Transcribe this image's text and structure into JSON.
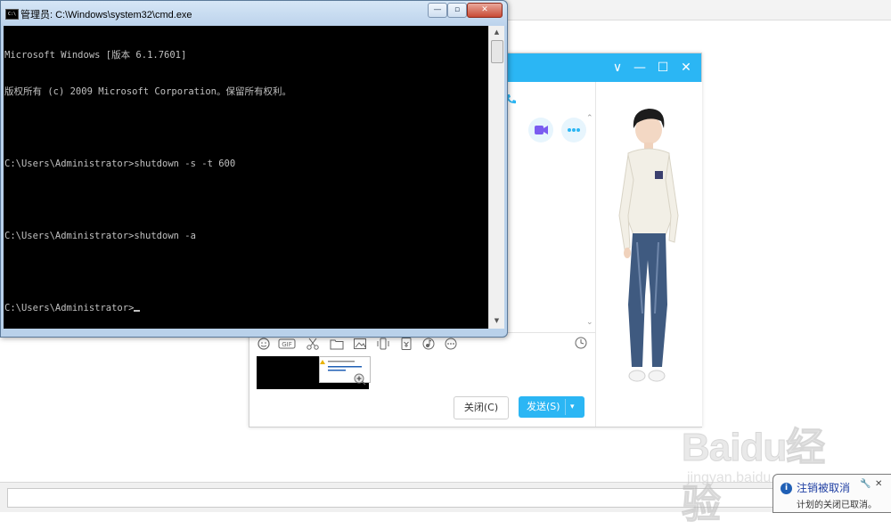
{
  "cmd_window": {
    "title": "管理员: C:\\Windows\\system32\\cmd.exe",
    "icon_label": "C:\\",
    "controls": {
      "minimize": "—",
      "maximize": "▫",
      "close": "✕"
    },
    "console_lines": [
      "Microsoft Windows [版本 6.1.7601]",
      "版权所有 (c) 2009 Microsoft Corporation。保留所有权利。",
      "",
      "C:\\Users\\Administrator>shutdown -s -t 600",
      "",
      "C:\\Users\\Administrator>shutdown -a",
      "",
      "C:\\Users\\Administrator>"
    ]
  },
  "chat_window": {
    "title_controls": {
      "collapse": "∨",
      "minimize": "—",
      "maximize": "☐",
      "close": "✕"
    },
    "close_button": "关闭(C)",
    "send_button": "发送(S)",
    "toolbar_icons": [
      "emoji-icon",
      "gif-icon",
      "scissors-icon",
      "folder-icon",
      "image-icon",
      "shake-icon",
      "red-packet-icon",
      "music-icon",
      "more-icon"
    ],
    "history_icon": "clock-icon",
    "accent_color": "#2bb6f4"
  },
  "watermark": {
    "text": "Baidu经验",
    "sub": "jingyan.baidu.com"
  },
  "notification": {
    "title": "注销被取消",
    "body": "计划的关闭已取消。"
  }
}
